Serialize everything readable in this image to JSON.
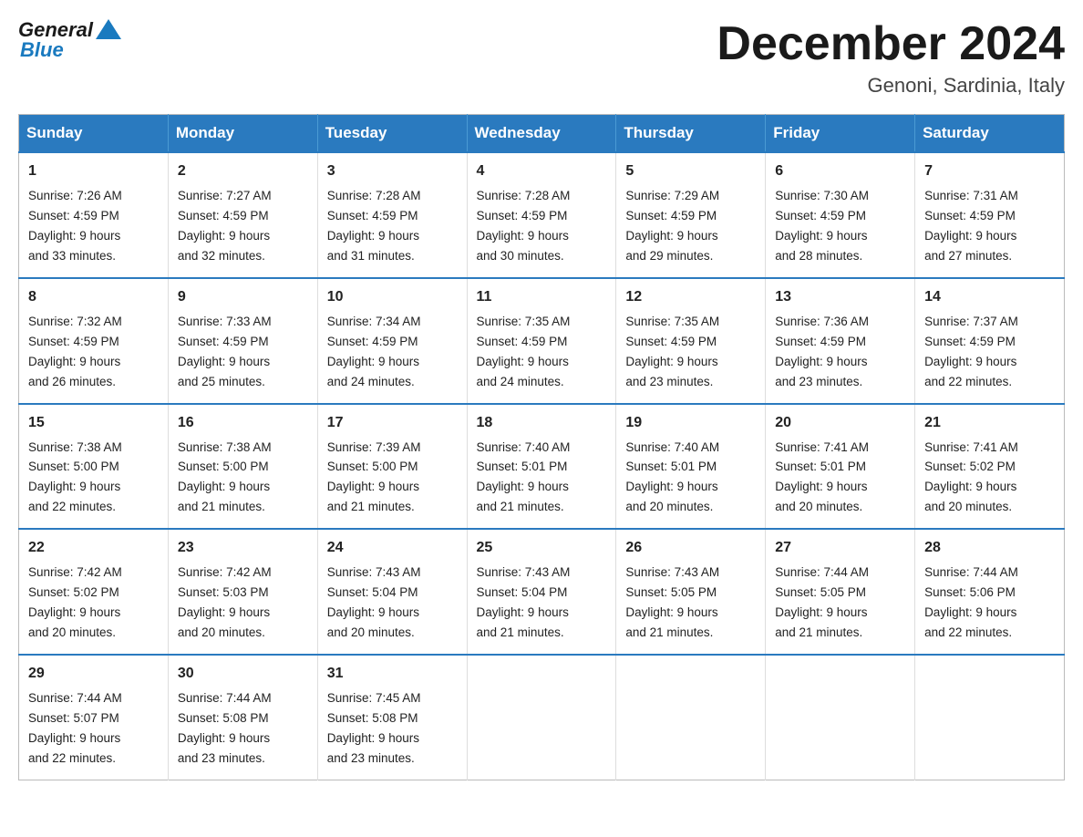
{
  "logo": {
    "general": "General",
    "blue": "Blue"
  },
  "title": "December 2024",
  "location": "Genoni, Sardinia, Italy",
  "days_of_week": [
    "Sunday",
    "Monday",
    "Tuesday",
    "Wednesday",
    "Thursday",
    "Friday",
    "Saturday"
  ],
  "weeks": [
    [
      {
        "day": "1",
        "sunrise": "7:26 AM",
        "sunset": "4:59 PM",
        "daylight": "9 hours and 33 minutes."
      },
      {
        "day": "2",
        "sunrise": "7:27 AM",
        "sunset": "4:59 PM",
        "daylight": "9 hours and 32 minutes."
      },
      {
        "day": "3",
        "sunrise": "7:28 AM",
        "sunset": "4:59 PM",
        "daylight": "9 hours and 31 minutes."
      },
      {
        "day": "4",
        "sunrise": "7:28 AM",
        "sunset": "4:59 PM",
        "daylight": "9 hours and 30 minutes."
      },
      {
        "day": "5",
        "sunrise": "7:29 AM",
        "sunset": "4:59 PM",
        "daylight": "9 hours and 29 minutes."
      },
      {
        "day": "6",
        "sunrise": "7:30 AM",
        "sunset": "4:59 PM",
        "daylight": "9 hours and 28 minutes."
      },
      {
        "day": "7",
        "sunrise": "7:31 AM",
        "sunset": "4:59 PM",
        "daylight": "9 hours and 27 minutes."
      }
    ],
    [
      {
        "day": "8",
        "sunrise": "7:32 AM",
        "sunset": "4:59 PM",
        "daylight": "9 hours and 26 minutes."
      },
      {
        "day": "9",
        "sunrise": "7:33 AM",
        "sunset": "4:59 PM",
        "daylight": "9 hours and 25 minutes."
      },
      {
        "day": "10",
        "sunrise": "7:34 AM",
        "sunset": "4:59 PM",
        "daylight": "9 hours and 24 minutes."
      },
      {
        "day": "11",
        "sunrise": "7:35 AM",
        "sunset": "4:59 PM",
        "daylight": "9 hours and 24 minutes."
      },
      {
        "day": "12",
        "sunrise": "7:35 AM",
        "sunset": "4:59 PM",
        "daylight": "9 hours and 23 minutes."
      },
      {
        "day": "13",
        "sunrise": "7:36 AM",
        "sunset": "4:59 PM",
        "daylight": "9 hours and 23 minutes."
      },
      {
        "day": "14",
        "sunrise": "7:37 AM",
        "sunset": "4:59 PM",
        "daylight": "9 hours and 22 minutes."
      }
    ],
    [
      {
        "day": "15",
        "sunrise": "7:38 AM",
        "sunset": "5:00 PM",
        "daylight": "9 hours and 22 minutes."
      },
      {
        "day": "16",
        "sunrise": "7:38 AM",
        "sunset": "5:00 PM",
        "daylight": "9 hours and 21 minutes."
      },
      {
        "day": "17",
        "sunrise": "7:39 AM",
        "sunset": "5:00 PM",
        "daylight": "9 hours and 21 minutes."
      },
      {
        "day": "18",
        "sunrise": "7:40 AM",
        "sunset": "5:01 PM",
        "daylight": "9 hours and 21 minutes."
      },
      {
        "day": "19",
        "sunrise": "7:40 AM",
        "sunset": "5:01 PM",
        "daylight": "9 hours and 20 minutes."
      },
      {
        "day": "20",
        "sunrise": "7:41 AM",
        "sunset": "5:01 PM",
        "daylight": "9 hours and 20 minutes."
      },
      {
        "day": "21",
        "sunrise": "7:41 AM",
        "sunset": "5:02 PM",
        "daylight": "9 hours and 20 minutes."
      }
    ],
    [
      {
        "day": "22",
        "sunrise": "7:42 AM",
        "sunset": "5:02 PM",
        "daylight": "9 hours and 20 minutes."
      },
      {
        "day": "23",
        "sunrise": "7:42 AM",
        "sunset": "5:03 PM",
        "daylight": "9 hours and 20 minutes."
      },
      {
        "day": "24",
        "sunrise": "7:43 AM",
        "sunset": "5:04 PM",
        "daylight": "9 hours and 20 minutes."
      },
      {
        "day": "25",
        "sunrise": "7:43 AM",
        "sunset": "5:04 PM",
        "daylight": "9 hours and 21 minutes."
      },
      {
        "day": "26",
        "sunrise": "7:43 AM",
        "sunset": "5:05 PM",
        "daylight": "9 hours and 21 minutes."
      },
      {
        "day": "27",
        "sunrise": "7:44 AM",
        "sunset": "5:05 PM",
        "daylight": "9 hours and 21 minutes."
      },
      {
        "day": "28",
        "sunrise": "7:44 AM",
        "sunset": "5:06 PM",
        "daylight": "9 hours and 22 minutes."
      }
    ],
    [
      {
        "day": "29",
        "sunrise": "7:44 AM",
        "sunset": "5:07 PM",
        "daylight": "9 hours and 22 minutes."
      },
      {
        "day": "30",
        "sunrise": "7:44 AM",
        "sunset": "5:08 PM",
        "daylight": "9 hours and 23 minutes."
      },
      {
        "day": "31",
        "sunrise": "7:45 AM",
        "sunset": "5:08 PM",
        "daylight": "9 hours and 23 minutes."
      },
      null,
      null,
      null,
      null
    ]
  ],
  "labels": {
    "sunrise": "Sunrise:",
    "sunset": "Sunset:",
    "daylight": "Daylight:"
  }
}
